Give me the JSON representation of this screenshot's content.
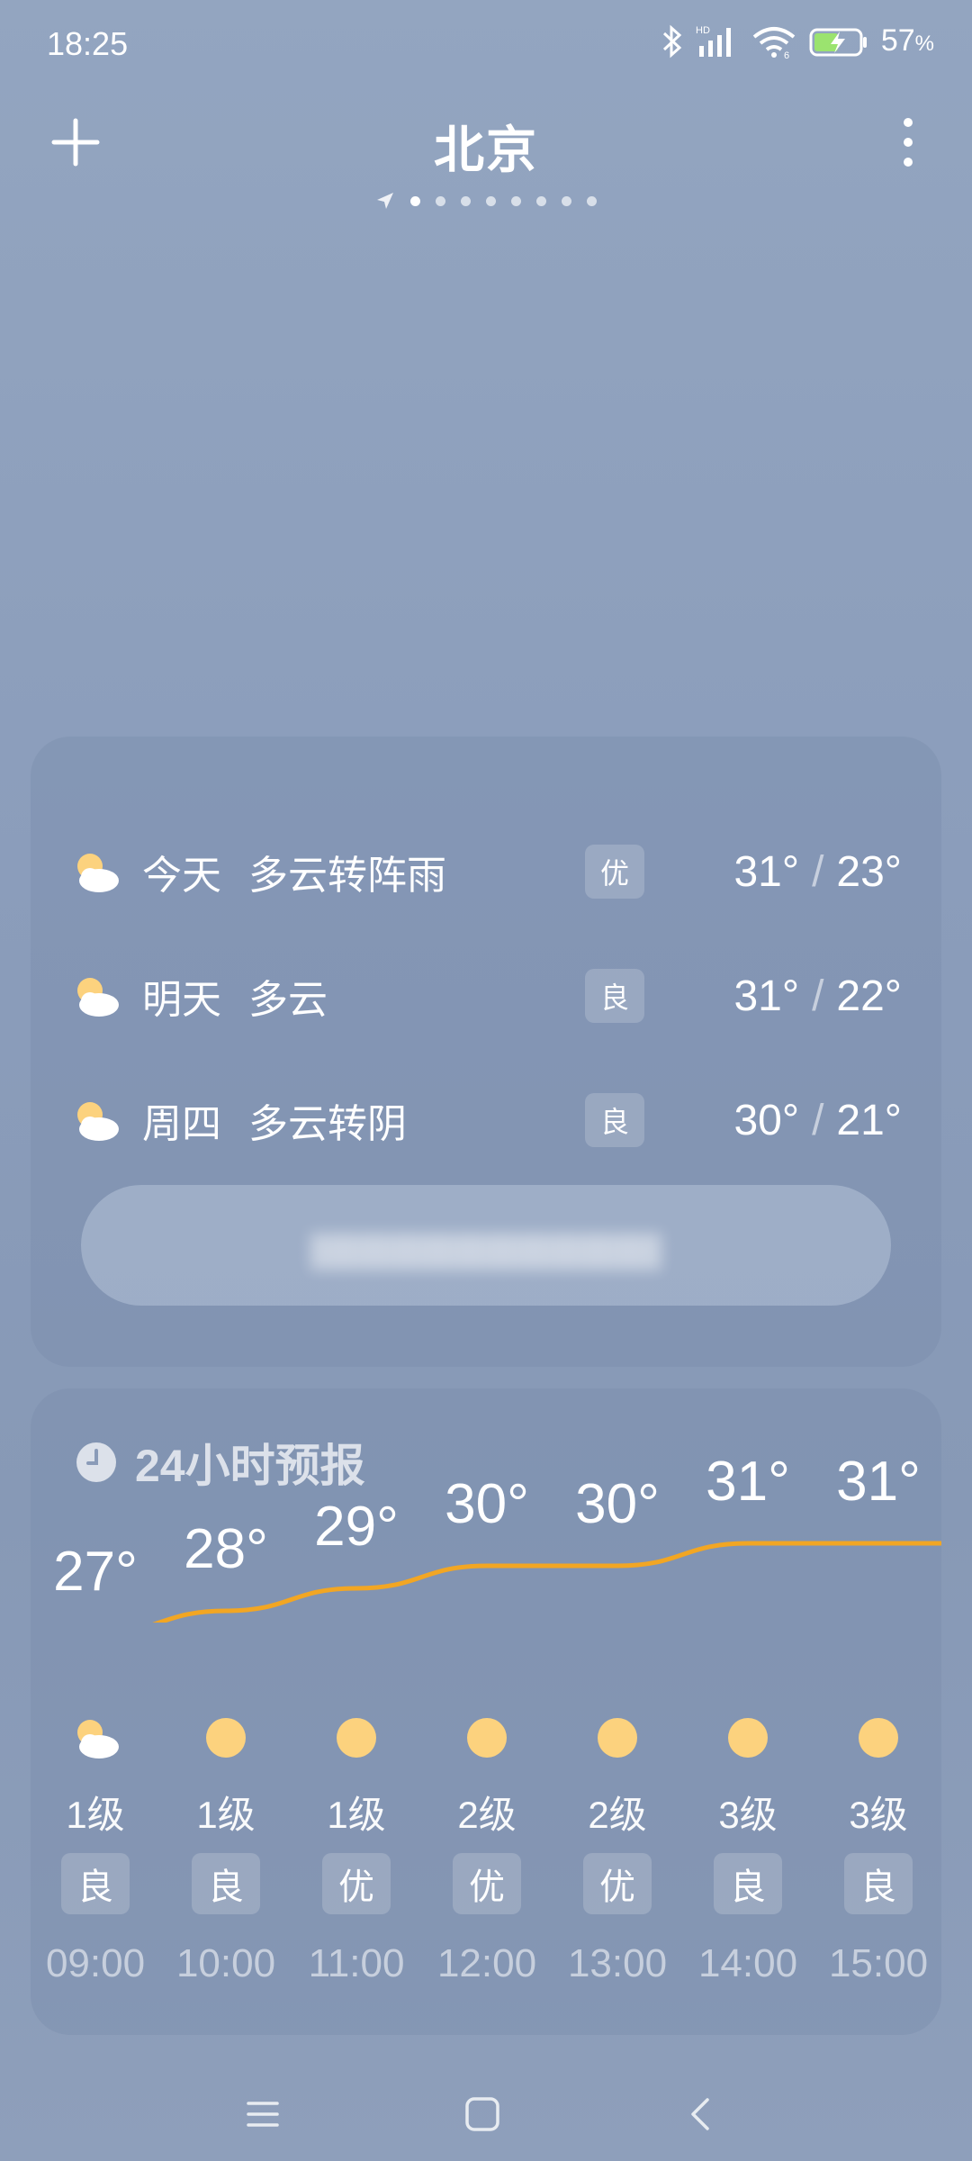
{
  "status_bar": {
    "time": "18:25",
    "battery": "57",
    "battery_unit": "%"
  },
  "header": {
    "city": "北京",
    "page_count": 8,
    "active_page": 1
  },
  "daily": [
    {
      "day": "今天",
      "condition": "多云转阵雨",
      "aqi": "优",
      "high": "31°",
      "low": "23°",
      "sep": "/"
    },
    {
      "day": "明天",
      "condition": "多云",
      "aqi": "良",
      "high": "31°",
      "low": "22°",
      "sep": "/"
    },
    {
      "day": "周四",
      "condition": "多云转阴",
      "aqi": "良",
      "high": "30°",
      "low": "21°",
      "sep": "/"
    }
  ],
  "hourly": {
    "title": "24小时预报",
    "hours": [
      {
        "time": "09:00",
        "temp": "27°",
        "temp_value": 27,
        "icon": "partly-cloudy-icon",
        "wind": "1级",
        "aqi": "良"
      },
      {
        "time": "10:00",
        "temp": "28°",
        "temp_value": 28,
        "icon": "sun-icon",
        "wind": "1级",
        "aqi": "良"
      },
      {
        "time": "11:00",
        "temp": "29°",
        "temp_value": 29,
        "icon": "sun-icon",
        "wind": "1级",
        "aqi": "优"
      },
      {
        "time": "12:00",
        "temp": "30°",
        "temp_value": 30,
        "icon": "sun-icon",
        "wind": "2级",
        "aqi": "优"
      },
      {
        "time": "13:00",
        "temp": "30°",
        "temp_value": 30,
        "icon": "sun-icon",
        "wind": "2级",
        "aqi": "优"
      },
      {
        "time": "14:00",
        "temp": "31°",
        "temp_value": 31,
        "icon": "sun-icon",
        "wind": "3级",
        "aqi": "良"
      },
      {
        "time": "15:00",
        "temp": "31°",
        "temp_value": 31,
        "icon": "sun-icon",
        "wind": "3级",
        "aqi": "良"
      }
    ]
  },
  "colors": {
    "curve": "#f2a623",
    "sun": "#fcd27e"
  }
}
